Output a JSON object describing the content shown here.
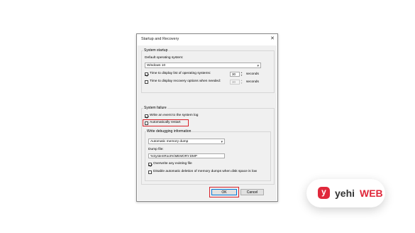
{
  "window": {
    "title": "Startup and Recovery",
    "close_glyph": "✕"
  },
  "system_startup": {
    "group_label": "System startup",
    "default_os_label": "Default operating system:",
    "default_os_value": "Windows 10",
    "time_display_list_label": "Time to display list of operating systems:",
    "time_display_list_checked": true,
    "time_display_list_value": "30",
    "time_display_recovery_label": "Time to display recovery options when needed:",
    "time_display_recovery_checked": false,
    "time_display_recovery_value": "30",
    "seconds_unit": "seconds"
  },
  "system_failure": {
    "group_label": "System failure",
    "write_event_label": "Write an event to the system log",
    "write_event_checked": true,
    "auto_restart_label": "Automatically restart",
    "auto_restart_checked": false,
    "debug_group_label": "Write debugging information",
    "debug_type_value": "Automatic memory dump",
    "dump_file_label": "Dump file:",
    "dump_file_value": "%SystemRoot%\\MEMORY.DMP",
    "overwrite_label": "Overwrite any existing file",
    "overwrite_checked": true,
    "disable_auto_delete_label": "Disable automatic deletion of memory dumps when disk space is low",
    "disable_auto_delete_checked": false
  },
  "buttons": {
    "ok": "OK",
    "cancel": "Cancel"
  },
  "colors": {
    "highlight": "#d9222a",
    "brand_red": "#e0283b"
  },
  "brand": {
    "part1": "yehi",
    "part2": "WEB",
    "icon": "yehiweb-logo-icon"
  }
}
